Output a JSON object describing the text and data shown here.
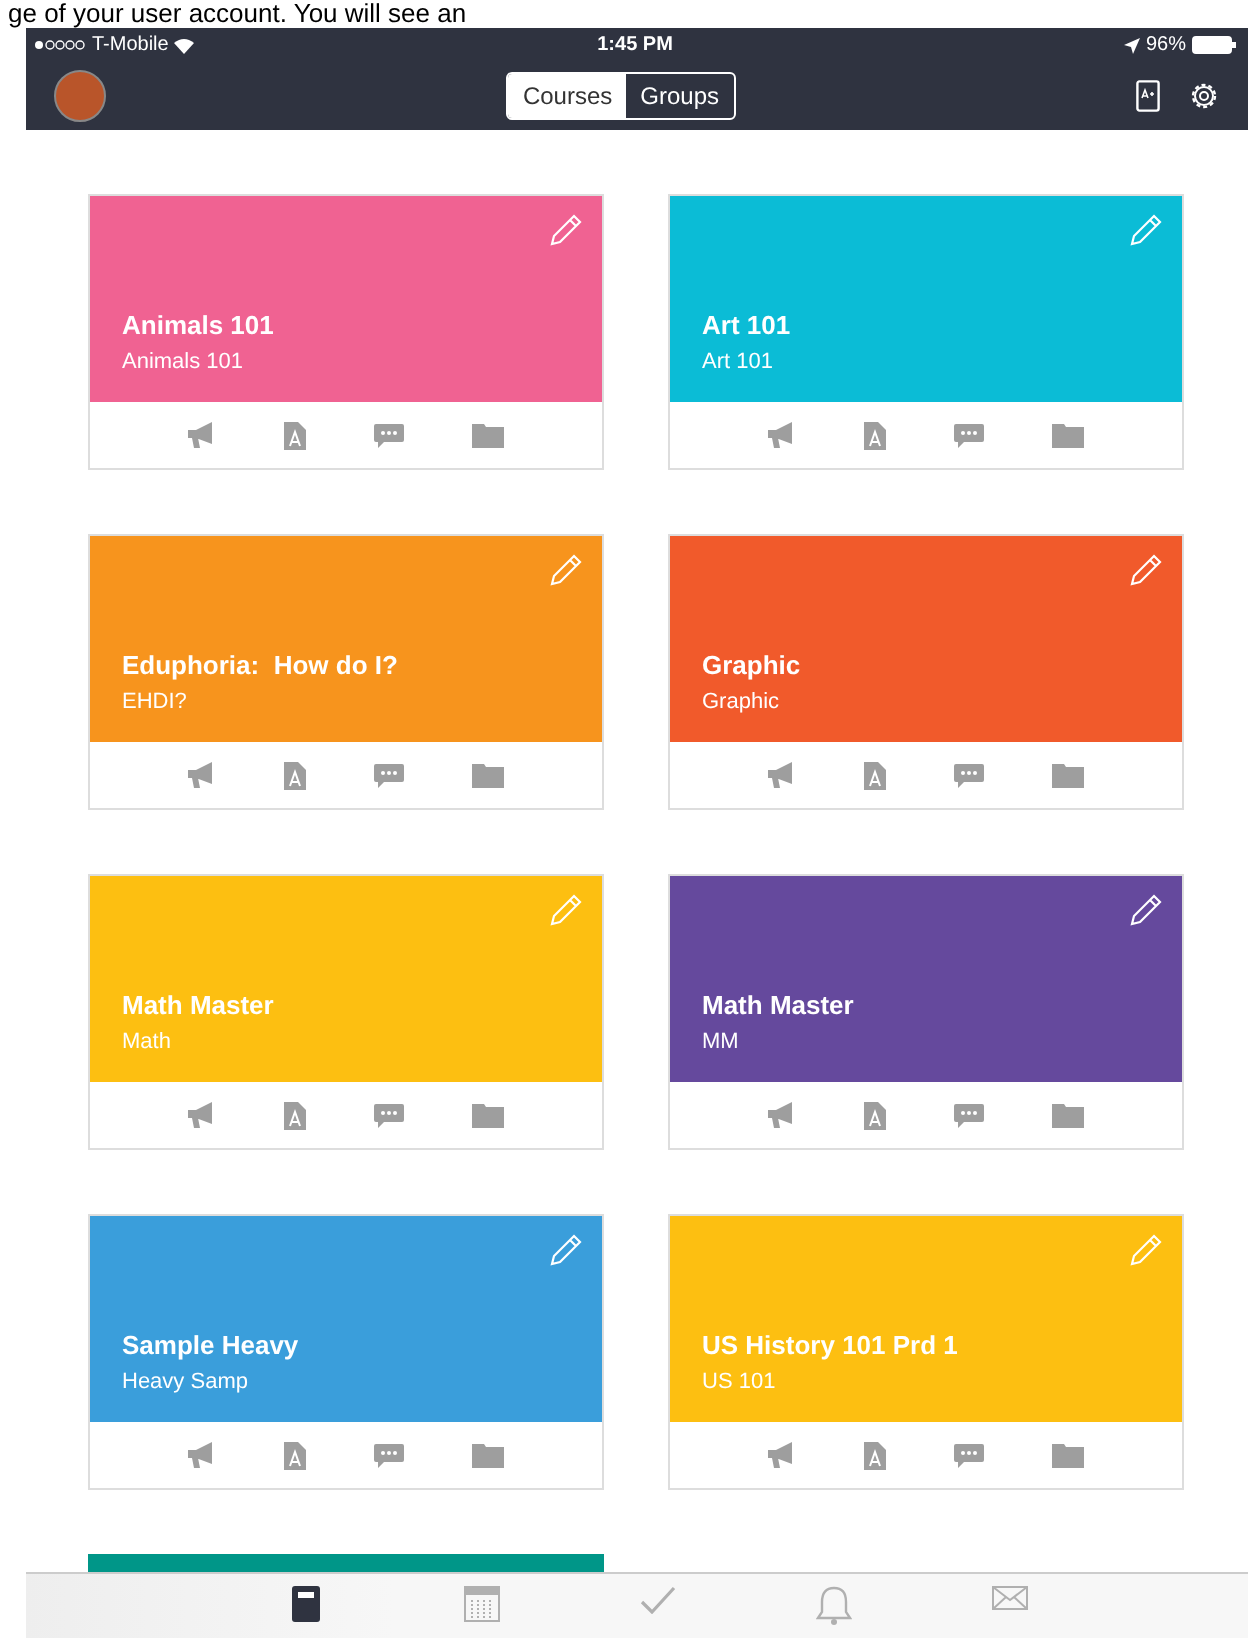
{
  "caption": "ge of your user account. You will see an",
  "status_bar": {
    "carrier": "T-Mobile",
    "time": "1:45 PM",
    "battery": "96%"
  },
  "segments": [
    {
      "label": "Courses",
      "selected": true
    },
    {
      "label": "Groups",
      "selected": false
    }
  ],
  "courses": [
    {
      "title": "Animals 101",
      "code": "Animals 101",
      "color": "#f06292"
    },
    {
      "title": "Art 101",
      "code": "Art 101",
      "color": "#0bbcd6"
    },
    {
      "title": "Eduphoria:  How do I?",
      "code": "EHDI?",
      "color": "#f7941d"
    },
    {
      "title": "Graphic",
      "code": "Graphic",
      "color": "#f15a2b"
    },
    {
      "title": "Math Master",
      "code": "Math",
      "color": "#fdbf11"
    },
    {
      "title": "Math Master",
      "code": "MM",
      "color": "#65499d"
    },
    {
      "title": "Sample Heavy",
      "code": "Heavy Samp",
      "color": "#3a9edb"
    },
    {
      "title": "US History 101 Prd 1",
      "code": "US 101",
      "color": "#fdbf11"
    }
  ],
  "cut_off_card": {
    "color": "#009688"
  },
  "tab_bar": [
    {
      "kind": "courses",
      "selected": true
    },
    {
      "kind": "calendar",
      "selected": false
    },
    {
      "kind": "todo",
      "selected": false
    },
    {
      "kind": "notifications",
      "selected": false
    },
    {
      "kind": "messages",
      "selected": false
    }
  ]
}
